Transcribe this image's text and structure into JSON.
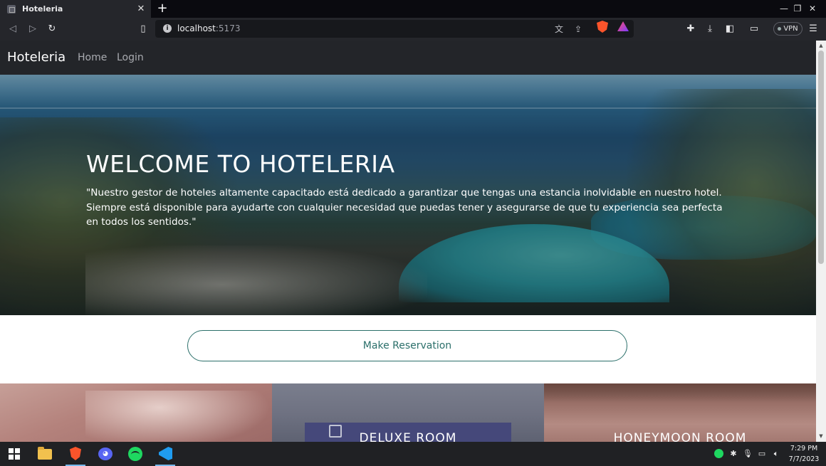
{
  "browser": {
    "tab_title": "Hoteleria",
    "tab_close": "✕",
    "new_tab": "+",
    "window_controls": {
      "minimize": "—",
      "restore": "❐",
      "close": "✕"
    },
    "url_host": "localhost",
    "url_port": ":5173",
    "vpn_label": "VPN",
    "icons": [
      "back-icon",
      "forward-icon",
      "reload-icon",
      "bookmark-icon",
      "site-info-icon",
      "translate-icon",
      "share-icon",
      "brave-shields-icon",
      "brave-rewards-icon",
      "extensions-icon",
      "downloads-icon",
      "sidebar-icon",
      "wallet-icon",
      "menu-icon"
    ]
  },
  "navbar": {
    "brand": "Hoteleria",
    "links": [
      "Home",
      "Login"
    ]
  },
  "hero": {
    "title": "WELCOME TO HOTELERIA",
    "text": "\"Nuestro gestor de hoteles altamente capacitado está dedicado a garantizar que tengas una estancia inolvidable en nuestro hotel. Siempre está disponible para ayudarte con cualquier necesidad que puedas tener y asegurarse de que tu experiencia sea perfecta en todos los sentidos.\""
  },
  "reservation_button": "Make Reservation",
  "rooms": [
    "",
    "DELUXE ROOM",
    "HONEYMOON ROOM"
  ],
  "taskbar": {
    "apps": [
      "start-icon",
      "file-explorer-icon",
      "brave-icon",
      "discord-icon",
      "spotify-icon",
      "vscode-icon"
    ],
    "time": "7:29 PM",
    "date": "7/7/2023",
    "colors": {
      "spotify": "#1ed760",
      "brave": "#fb542b",
      "discord": "#5865f2",
      "vscode": "#1f9cf0",
      "accent": "#2b6f6a"
    }
  }
}
